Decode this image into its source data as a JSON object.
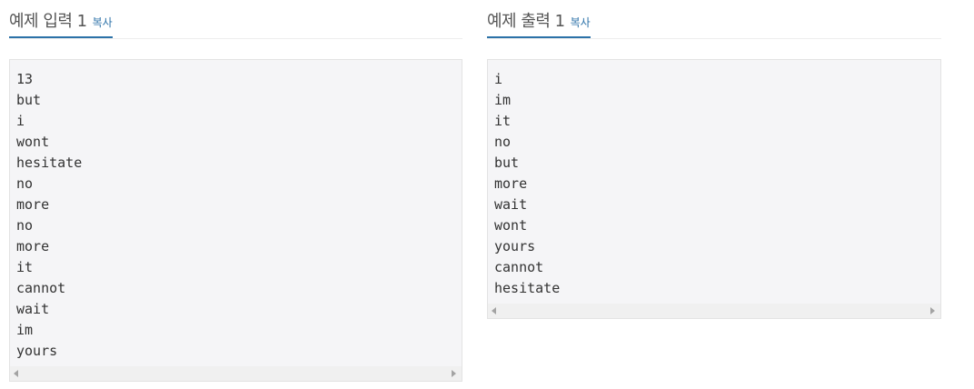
{
  "sample_input": {
    "title": "예제 입력 1",
    "copy_label": "복사",
    "lines": [
      "13",
      "but",
      "i",
      "wont",
      "hesitate",
      "no",
      "more",
      "no",
      "more",
      "it",
      "cannot",
      "wait",
      "im",
      "yours"
    ]
  },
  "sample_output": {
    "title": "예제 출력 1",
    "copy_label": "복사",
    "lines": [
      "i",
      "im",
      "it",
      "no",
      "but",
      "more",
      "wait",
      "wont",
      "yours",
      "cannot",
      "hesitate"
    ]
  },
  "colors": {
    "accent": "#2c72a8",
    "box_background": "#f5f5f7",
    "title_text": "#555555"
  }
}
